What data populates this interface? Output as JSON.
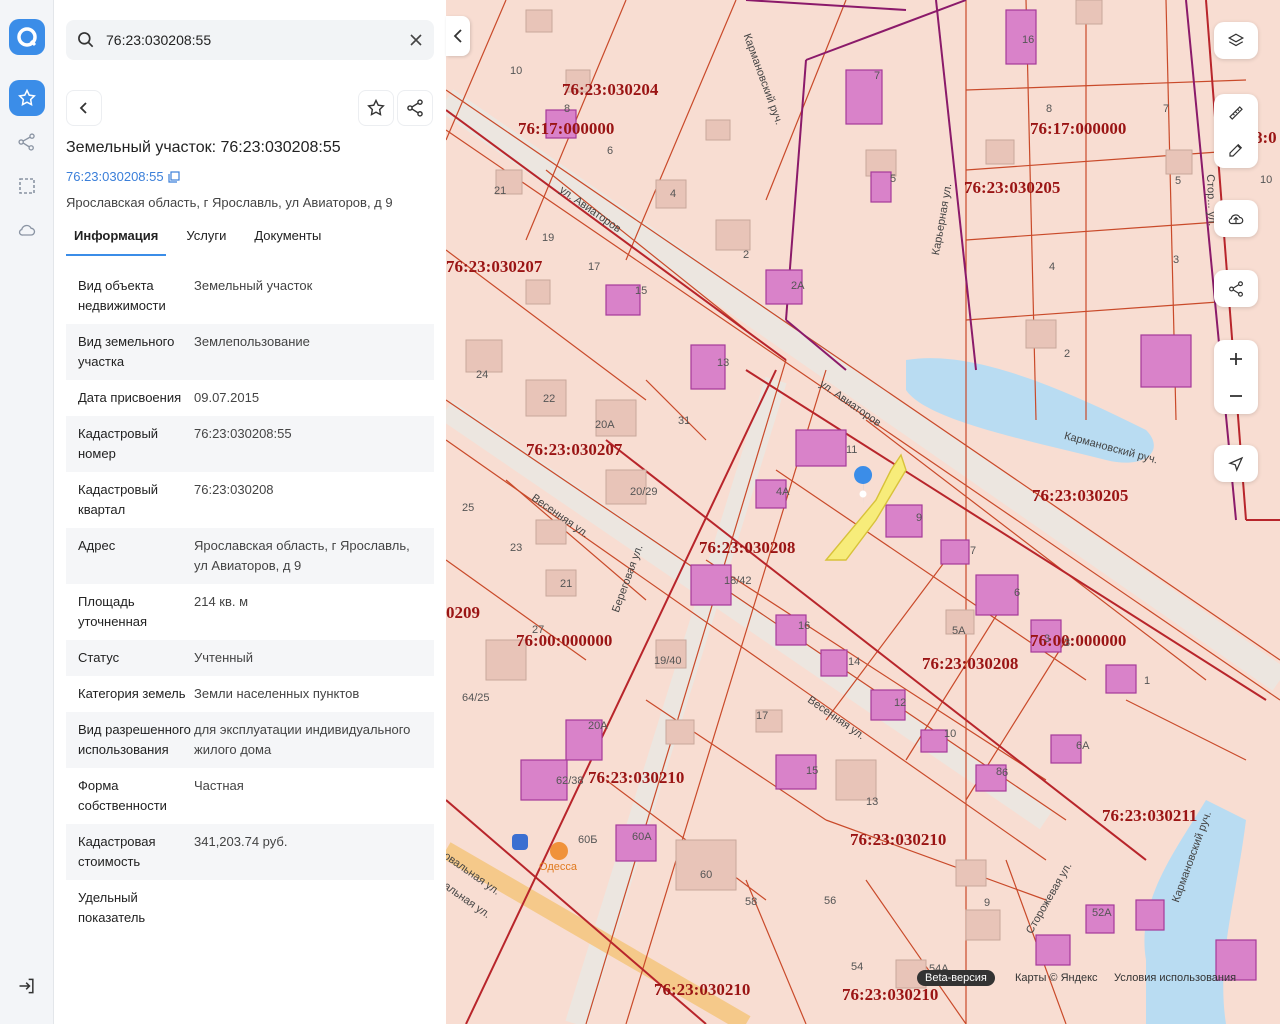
{
  "search": {
    "value": "76:23:030208:55"
  },
  "object": {
    "title": "Земельный участок: 76:23:030208:55",
    "cad_number": "76:23:030208:55",
    "address": "Ярославская область, г Ярославль, ул Авиаторов, д 9"
  },
  "tabs": [
    {
      "label": "Информация",
      "active": true
    },
    {
      "label": "Услуги"
    },
    {
      "label": "Документы"
    }
  ],
  "info": [
    {
      "key": "Вид объекта недвижимости",
      "value": "Земельный участок"
    },
    {
      "key": "Вид земельного участка",
      "value": "Землепользование"
    },
    {
      "key": "Дата присвоения",
      "value": "09.07.2015"
    },
    {
      "key": "Кадастровый номер",
      "value": "76:23:030208:55"
    },
    {
      "key": "Кадастровый квартал",
      "value": "76:23:030208"
    },
    {
      "key": "Адрес",
      "value": "Ярославская область, г Ярославль, ул Авиаторов, д 9"
    },
    {
      "key": "Площадь уточненная",
      "value": "214 кв. м"
    },
    {
      "key": "Статус",
      "value": "Учтенный"
    },
    {
      "key": "Категория земель",
      "value": "Земли населенных пунктов"
    },
    {
      "key": "Вид разрешенного использования",
      "value": "для эксплуатации индивидуального жилого дома"
    },
    {
      "key": "Форма собственности",
      "value": "Частная"
    },
    {
      "key": "Кадастровая стоимость",
      "value": "341,203.74 руб."
    },
    {
      "key": "Удельный показатель",
      "value": ""
    }
  ],
  "map": {
    "cad_labels": [
      "76:23:030204",
      "76:17:000000",
      "76:17:000000",
      "76:23:030205",
      "76:23:030207",
      "76:23:030207",
      "76:23:030205",
      "76:23:030208",
      "0209",
      "76:00:000000",
      "76:00:000000",
      "76:23:030208",
      "76:23:030210",
      "76:23:030210",
      "76:23:030211",
      "76:23:030210",
      "76:23:030210",
      "8:0"
    ],
    "house_numbers": [
      "10",
      "8",
      "6",
      "4",
      "2",
      "2А",
      "7",
      "5",
      "16",
      "8",
      "7",
      "10",
      "5",
      "3",
      "4",
      "2",
      "21",
      "19",
      "17",
      "15",
      "13",
      "24",
      "22",
      "20А",
      "31",
      "20/29",
      "11",
      "4А",
      "9",
      "7",
      "6",
      "25",
      "23",
      "21",
      "27",
      "18/42",
      "16",
      "14",
      "5А",
      "3",
      "1",
      "19/40",
      "17",
      "15",
      "12",
      "10",
      "6А",
      "8",
      "64/25",
      "62/38",
      "20А",
      "60Б",
      "60А",
      "60",
      "58",
      "13",
      "9",
      "56",
      "54",
      "54А",
      "52А",
      "6",
      "3"
    ],
    "streets": [
      "ул. Авиаторов",
      "ул. Авиаторов",
      "Весенняя ул.",
      "Береговая ул.",
      "Весенняя ул.",
      "Карьерная ул.",
      "Кармановский руч.",
      "Кармановский руч.",
      "Кармановский руч.",
      "Сторожевая ул.",
      "Стор... ул.",
      "овальная ул.",
      "альная ул."
    ],
    "poi": "Одесса",
    "beta": "Beta-версия",
    "copyright": "Карты © Яндекс",
    "terms": "Условия использования"
  }
}
